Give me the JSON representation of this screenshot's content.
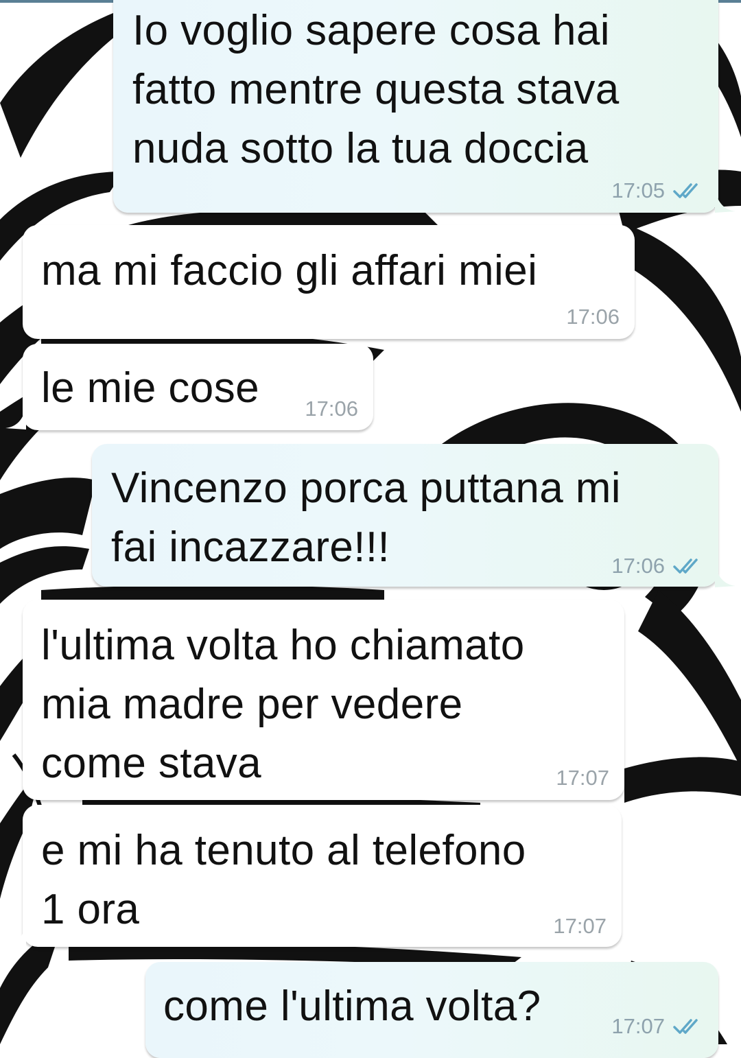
{
  "chat": {
    "messages": [
      {
        "id": "m1",
        "direction": "out",
        "text": "Io voglio sapere cosa hai\nfatto mentre questa stava\nnuda sotto la tua doccia",
        "time": "17:05",
        "status_icon": "double-check-icon"
      },
      {
        "id": "m2",
        "direction": "in",
        "text": "ma mi faccio gli affari miei",
        "time": "17:06"
      },
      {
        "id": "m3",
        "direction": "in",
        "text": "le mie cose",
        "time": "17:06"
      },
      {
        "id": "m4",
        "direction": "out",
        "text": "Vincenzo porca puttana mi\nfai incazzare!!!",
        "time": "17:06",
        "status_icon": "double-check-icon"
      },
      {
        "id": "m5",
        "direction": "in",
        "text": "l'ultima volta ho chiamato\nmia madre per vedere\ncome stava",
        "time": "17:07"
      },
      {
        "id": "m6",
        "direction": "in",
        "text": "e mi ha tenuto al telefono\n1 ora",
        "time": "17:07"
      },
      {
        "id": "m7",
        "direction": "out",
        "text": "come l'ultima volta?",
        "time": "17:07",
        "status_icon": "double-check-icon"
      }
    ]
  },
  "colors": {
    "incoming_bubble": "#ffffff",
    "outgoing_bubble": "#eaf6fb",
    "time_text": "#9aa3a9",
    "read_check": "#5fa8c8",
    "wallpaper_ink": "#111111"
  }
}
